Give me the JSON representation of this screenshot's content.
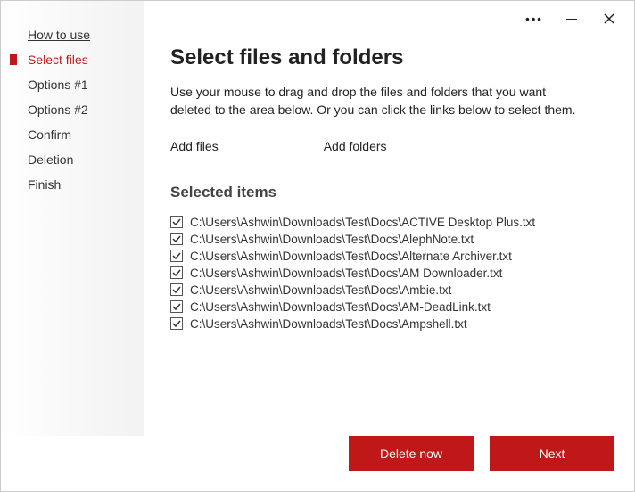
{
  "titlebar": {
    "dots": "•••"
  },
  "sidebar": {
    "items": [
      {
        "label": "How to use",
        "active": false,
        "underline": true
      },
      {
        "label": "Select files",
        "active": true,
        "underline": false
      },
      {
        "label": "Options #1",
        "active": false,
        "underline": false
      },
      {
        "label": "Options #2",
        "active": false,
        "underline": false
      },
      {
        "label": "Confirm",
        "active": false,
        "underline": false
      },
      {
        "label": "Deletion",
        "active": false,
        "underline": false
      },
      {
        "label": "Finish",
        "active": false,
        "underline": false
      }
    ]
  },
  "main": {
    "title": "Select files and folders",
    "subtitle": "Use your mouse to drag and drop the files and folders that you want deleted to the area below. Or you can click the links below to select them.",
    "add_files_label": "Add files",
    "add_folders_label": "Add folders",
    "section_title": "Selected items",
    "items": [
      {
        "checked": true,
        "path": "C:\\Users\\Ashwin\\Downloads\\Test\\Docs\\ACTIVE Desktop Plus.txt"
      },
      {
        "checked": true,
        "path": "C:\\Users\\Ashwin\\Downloads\\Test\\Docs\\AlephNote.txt"
      },
      {
        "checked": true,
        "path": "C:\\Users\\Ashwin\\Downloads\\Test\\Docs\\Alternate Archiver.txt"
      },
      {
        "checked": true,
        "path": "C:\\Users\\Ashwin\\Downloads\\Test\\Docs\\AM Downloader.txt"
      },
      {
        "checked": true,
        "path": "C:\\Users\\Ashwin\\Downloads\\Test\\Docs\\Ambie.txt"
      },
      {
        "checked": true,
        "path": "C:\\Users\\Ashwin\\Downloads\\Test\\Docs\\AM-DeadLink.txt"
      },
      {
        "checked": true,
        "path": "C:\\Users\\Ashwin\\Downloads\\Test\\Docs\\Ampshell.txt"
      }
    ]
  },
  "footer": {
    "delete_label": "Delete now",
    "next_label": "Next"
  }
}
